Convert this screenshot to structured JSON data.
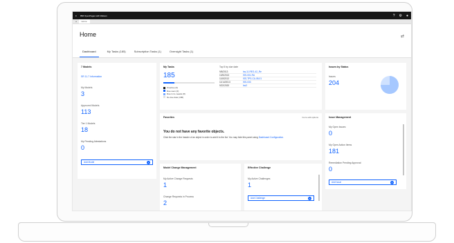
{
  "browser": {
    "product": "IBM OpenPages with Watson",
    "tab_title": "Home"
  },
  "page": {
    "title": "Home",
    "tabs": [
      "Dashboard",
      "My Tasks (185)",
      "Subscription Tasks (1)",
      "Oversight Tasks (1)"
    ],
    "active_tab": 0
  },
  "models_card": {
    "title": "7 Models",
    "link": "SR 11-7 Information",
    "metrics": [
      {
        "label": "My Models",
        "value": "3"
      },
      {
        "label": "Approved Models",
        "value": "113"
      },
      {
        "label": "Tier 1 Models",
        "value": "18"
      },
      {
        "label": "My Pending Attestations",
        "value": "0"
      }
    ],
    "add_button": "Add Model"
  },
  "my_tasks": {
    "title": "My Tasks",
    "count": "185",
    "progress_fraction": 0.22,
    "legend": [
      {
        "label": "Overdue (0)",
        "color": "#161616"
      },
      {
        "label": "Due soon (0)",
        "color": "#0f62fe"
      },
      {
        "label": "Due in 2+ weeks (8)",
        "color": "#78a9ff"
      },
      {
        "label": "No due date (186)",
        "color": "#e0e0e0"
      }
    ],
    "top5_title": "Top 5 by due date",
    "top5": [
      {
        "date": "9/8/2013",
        "name": "Iss-11-REG-42_Re"
      },
      {
        "date": "10/5/2013",
        "name": "ISS-001-RA"
      },
      {
        "date": "11/8/2013",
        "name": "ISS-TPS-CA-08-01"
      },
      {
        "date": "11/14/2013",
        "name": "ISS-033"
      },
      {
        "date": "9/22/2020",
        "name": "Iss3"
      }
    ]
  },
  "issues_status": {
    "title": "Issues by Status",
    "label": "Issues",
    "count": "204",
    "pie_fraction_highlight": 0.75
  },
  "favorites": {
    "title": "Favorites",
    "edit_label": "Go to edit options",
    "empty_title": "You do not have any favorite objects.",
    "empty_text": "Click the star in the header of an object in order to add it to the list. You may hide this panel using",
    "empty_link": "Dashboard Configuration."
  },
  "model_change": {
    "title": "Model Change Management",
    "metrics": [
      {
        "label": "My Active Change Requests",
        "value": "1"
      },
      {
        "label": "Change Requests in Process",
        "value": "2"
      }
    ]
  },
  "effective_challenge": {
    "title": "Effective Challenge",
    "metric": {
      "label": "My Active Challenges",
      "value": "1"
    },
    "add_button": "Add Challenge"
  },
  "issue_mgmt": {
    "title": "Issue Management",
    "metrics": [
      {
        "label": "My Open Issues",
        "value": "0"
      },
      {
        "label": "My Open Action Items",
        "value": "181"
      },
      {
        "label": "Remediation Pending Approval",
        "value": "0"
      }
    ],
    "add_button": "Add Issue"
  }
}
